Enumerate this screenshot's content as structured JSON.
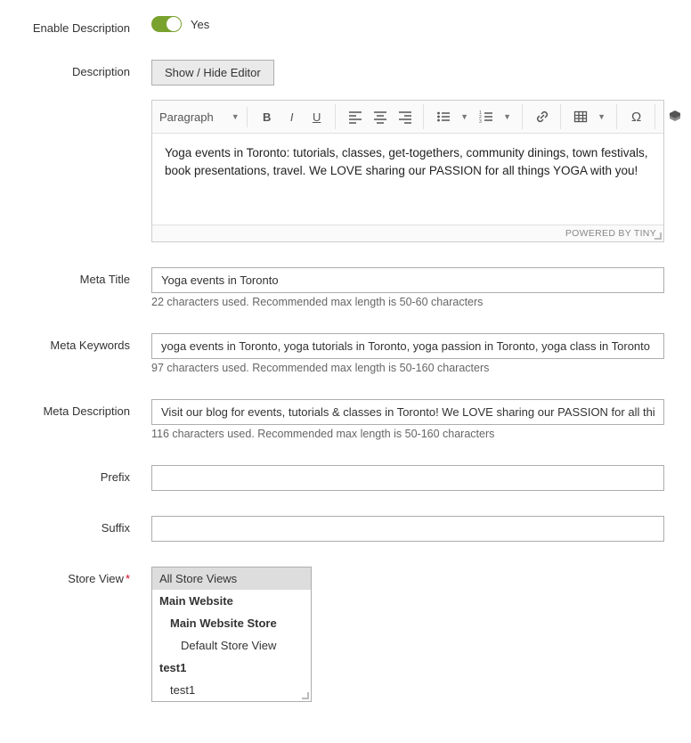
{
  "enable_description": {
    "label": "Enable Description",
    "value_text": "Yes"
  },
  "description": {
    "label": "Description",
    "toggle_editor_btn": "Show / Hide Editor",
    "format_selector": "Paragraph",
    "body": "Yoga events in Toronto: tutorials, classes, get-togethers, community dinings, town festivals, book presentations, travel. We LOVE sharing our PASSION for all things YOGA with you!",
    "powered": "POWERED BY TINY"
  },
  "meta_title": {
    "label": "Meta Title",
    "value": "Yoga events in Toronto",
    "hint": "22 characters used. Recommended max length is 50-60 characters"
  },
  "meta_keywords": {
    "label": "Meta Keywords",
    "value": "yoga events in Toronto, yoga tutorials in Toronto, yoga passion in Toronto, yoga class in Toronto",
    "hint": "97 characters used. Recommended max length is 50-160 characters"
  },
  "meta_description": {
    "label": "Meta Description",
    "value": "Visit our blog for events, tutorials & classes in Toronto! We LOVE sharing our PASSION for all things YOGA with you",
    "hint": "116 characters used. Recommended max length is 50-160 characters"
  },
  "prefix": {
    "label": "Prefix",
    "value": ""
  },
  "suffix": {
    "label": "Suffix",
    "value": ""
  },
  "store_view": {
    "label": "Store View",
    "options": [
      {
        "text": "All Store Views",
        "selected": true
      },
      {
        "text": "Main Website",
        "bold": true
      },
      {
        "text": "Main Website Store",
        "bold": true,
        "indent": 1
      },
      {
        "text": "Default Store View",
        "indent": 2
      },
      {
        "text": "test1",
        "bold": true
      },
      {
        "text": "test1",
        "indent": 1
      }
    ]
  }
}
